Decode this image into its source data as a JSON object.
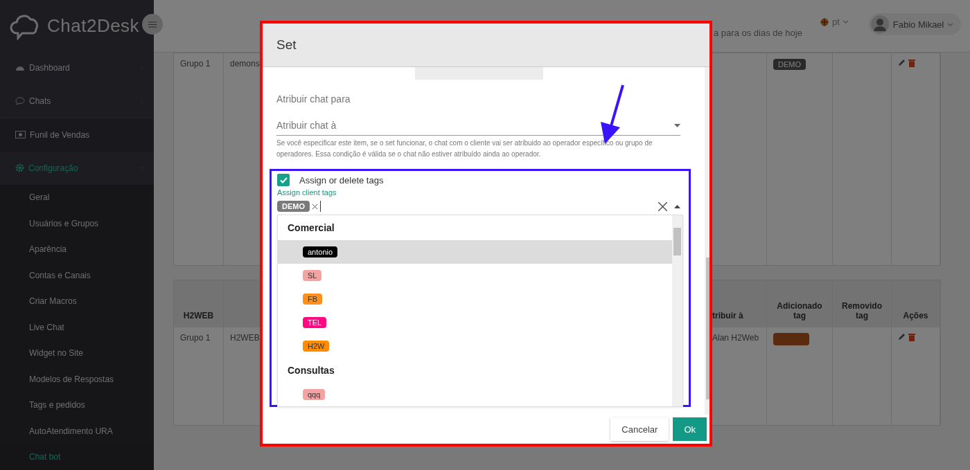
{
  "sidebar": {
    "logo": "Chat2Desk",
    "items": [
      {
        "label": "Dashboard",
        "kind": "submenu",
        "selected": false,
        "expanded": false
      },
      {
        "label": "Chats",
        "kind": "submenu",
        "selected": false,
        "expanded": false
      },
      {
        "label": "Funil de Vendas",
        "kind": "link",
        "selected": false,
        "expanded": false
      },
      {
        "label": "Configuração",
        "kind": "submenu",
        "selected": true,
        "expanded": true,
        "children": [
          {
            "label": "Geral",
            "selected": false
          },
          {
            "label": "Usuários e Grupos",
            "selected": false
          },
          {
            "label": "Aparência",
            "selected": false
          },
          {
            "label": "Contas e Canais",
            "selected": false
          },
          {
            "label": "Criar Macros",
            "selected": false
          },
          {
            "label": "Live Chat",
            "selected": false
          },
          {
            "label": "Widget no Site",
            "selected": false
          },
          {
            "label": "Modelos de Respostas",
            "selected": false
          },
          {
            "label": "Tags e pedidos",
            "selected": false
          },
          {
            "label": "AutoAtendimento URA",
            "selected": false
          },
          {
            "label": "Chat bot",
            "selected": true
          }
        ]
      }
    ]
  },
  "topbar": {
    "subtitle": "a para os dias de hoje",
    "language": "pt",
    "user": "Fabio Mikael"
  },
  "table_1": {
    "row": {
      "group": "Grupo 1",
      "name": "demons",
      "tag": "DEMO"
    }
  },
  "table_2": {
    "columns": [
      "H2WEB",
      "tribuir à",
      "Adicionado tag",
      "Removido tag",
      "Ações"
    ],
    "row": {
      "group": "Grupo 1",
      "name": "H2WEB",
      "assign": "Alan H2Web"
    }
  },
  "modal": {
    "title": "Set",
    "assign_label": "Atribuir chat para",
    "assign_placeholder": "Atribuir chat à",
    "assign_help": "Se você especificar este item, se o set funcionar, o chat com o cliente vai ser atribuido ao operador específico ou grupo de operadores. Essa condição é válida se o chat não estiver atribuído ainda ao operador.",
    "tags_checkbox": {
      "label": "Assign or delete tags",
      "checked": true
    },
    "tags_link": "Assign client tags",
    "selected_tags": [
      {
        "label": "DEMO",
        "color": "#7a7a7a"
      }
    ],
    "dropdown": [
      {
        "kind": "group",
        "label": "Comercial"
      },
      {
        "kind": "option",
        "label": "antonio",
        "color": "#000000",
        "selected": true
      },
      {
        "kind": "option",
        "label": "SL",
        "color": "#f4a3a3",
        "selected": false
      },
      {
        "kind": "option",
        "label": "FB",
        "color": "#ff8f1f",
        "selected": false
      },
      {
        "kind": "option",
        "label": "TEL",
        "color": "#ff0a80",
        "selected": false
      },
      {
        "kind": "option",
        "label": "H2W",
        "color": "#ff8c00",
        "selected": false
      },
      {
        "kind": "group",
        "label": "Consultas"
      },
      {
        "kind": "option",
        "label": "qqq",
        "color": "#f4a3a3",
        "selected": false
      }
    ],
    "buttons": [
      {
        "label": "Cancelar",
        "kind": "secondary"
      },
      {
        "label": "Ok",
        "kind": "primary"
      }
    ]
  }
}
